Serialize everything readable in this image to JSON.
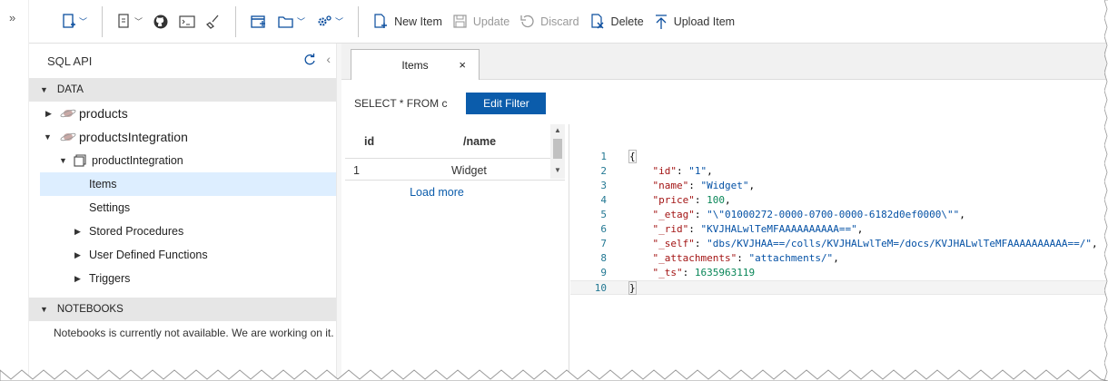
{
  "toolbar": {
    "new_item": "New Item",
    "update": "Update",
    "discard": "Discard",
    "delete": "Delete",
    "upload_item": "Upload Item"
  },
  "sidebar": {
    "title": "SQL API",
    "data_section": "DATA",
    "databases": [
      {
        "name": "products",
        "expanded": false
      },
      {
        "name": "productsIntegration",
        "expanded": true
      }
    ],
    "container": "productIntegration",
    "container_items": {
      "items": "Items",
      "settings": "Settings",
      "stored_procedures": "Stored Procedures",
      "udfs": "User Defined Functions",
      "triggers": "Triggers"
    },
    "notebooks_section": "NOTEBOOKS",
    "notebooks_message": "Notebooks is currently not available. We are working on it."
  },
  "tab": {
    "label": "Items",
    "close": "×"
  },
  "query": {
    "text": "SELECT * FROM c",
    "edit_filter": "Edit Filter"
  },
  "results": {
    "columns": [
      "id",
      "/name"
    ],
    "rows": [
      [
        "1",
        "Widget"
      ]
    ],
    "load_more": "Load more"
  },
  "editor": {
    "line_numbers": [
      "1",
      "2",
      "3",
      "4",
      "5",
      "6",
      "7",
      "8",
      "9",
      "10"
    ],
    "lines": [
      {
        "plain": "{"
      },
      {
        "key": "\"id\"",
        "val": "\"1\"",
        "type": "s",
        "comma": ","
      },
      {
        "key": "\"name\"",
        "val": "\"Widget\"",
        "type": "s",
        "comma": ","
      },
      {
        "key": "\"price\"",
        "val": "100",
        "type": "n",
        "comma": ","
      },
      {
        "key": "\"_etag\"",
        "val": "\"\\\"01000272-0000-0700-0000-6182d0ef0000\\\"\"",
        "type": "s",
        "comma": ","
      },
      {
        "key": "\"_rid\"",
        "val": "\"KVJHALwlTeMFAAAAAAAAAA==\"",
        "type": "s",
        "comma": ","
      },
      {
        "key": "\"_self\"",
        "val": "\"dbs/KVJHAA==/colls/KVJHALwlTeM=/docs/KVJHALwlTeMFAAAAAAAAAA==/\"",
        "type": "s",
        "comma": ","
      },
      {
        "key": "\"_attachments\"",
        "val": "\"attachments/\"",
        "type": "s",
        "comma": ","
      },
      {
        "key": "\"_ts\"",
        "val": "1635963119",
        "type": "n",
        "comma": ""
      },
      {
        "plain": "}"
      }
    ]
  },
  "colors": {
    "accent": "#0b5cab",
    "selected_row": "#ddeeff",
    "section_bg": "#e6e6e6"
  }
}
